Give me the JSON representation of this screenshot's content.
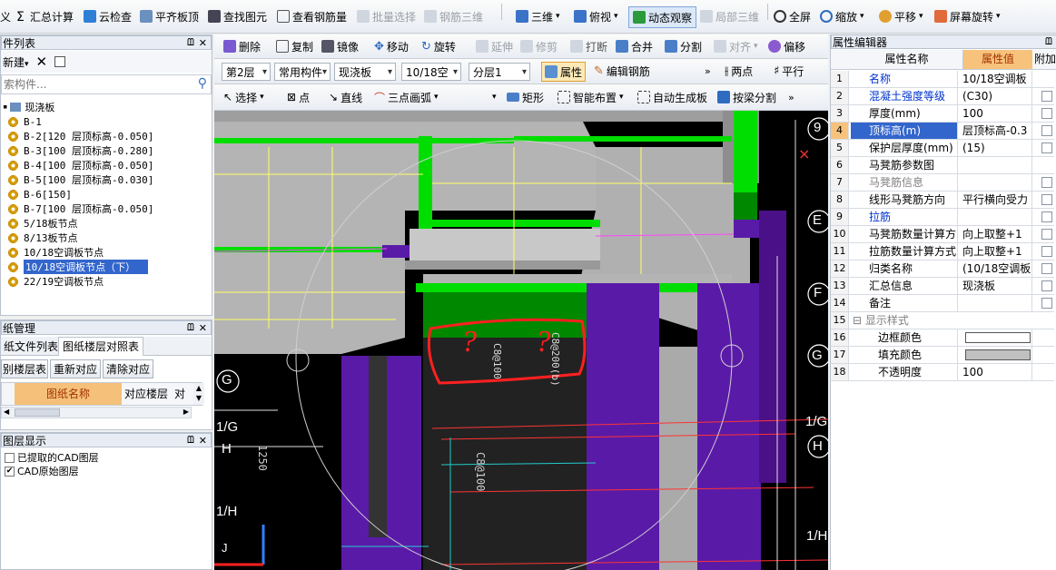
{
  "toolbar1": {
    "items": [
      "义",
      "汇总计算",
      "云检查",
      "平齐板顶",
      "查找图元",
      "查看钢筋量",
      "批量选择",
      "钢筋三维",
      "三维",
      "俯视",
      "动态观察",
      "局部三维",
      "全屏",
      "缩放",
      "平移",
      "屏幕旋转"
    ]
  },
  "left_panel": {
    "title": "件列表",
    "new_label": "新建",
    "search_placeholder": "索构件...",
    "root": "现浇板",
    "items": [
      "B-1",
      "B-2[120 层顶标高-0.050]",
      "B-3[100 层顶标高-0.280]",
      "B-4[100 层顶标高-0.050]",
      "B-5[100 层顶标高-0.030]",
      "B-6[150]",
      "B-7[100 层顶标高-0.050]",
      "5/18板节点",
      "8/13板节点",
      "10/18空调板节点",
      "10/18空调板节点（下）",
      "22/19空调板节点"
    ],
    "selected_index": 10
  },
  "drawing_panel": {
    "title": "纸管理",
    "tabs": [
      "纸文件列表",
      "图纸楼层对照表"
    ],
    "buttons": [
      "别楼层表",
      "重新对应",
      "清除对应"
    ],
    "columns": [
      "图纸名称",
      "对应楼层",
      "对应"
    ]
  },
  "layer_panel": {
    "title": "图层显示",
    "layers": [
      {
        "label": "已提取的CAD图层",
        "checked": false
      },
      {
        "label": "CAD原始图层",
        "checked": true
      }
    ]
  },
  "edit_toolbar": {
    "row1": [
      "删除",
      "复制",
      "镜像",
      "移动",
      "旋转",
      "延伸",
      "修剪",
      "打断",
      "合并",
      "分割",
      "对齐",
      "偏移"
    ],
    "row2_combos": [
      "第2层",
      "常用构件",
      "现浇板",
      "10/18空",
      "分层1"
    ],
    "row2_buttons": [
      "属性",
      "编辑钢筋",
      "两点",
      "平行"
    ],
    "row3": [
      "选择",
      "点",
      "直线",
      "三点画弧",
      "矩形",
      "智能布置",
      "自动生成板",
      "按梁分割"
    ]
  },
  "viewport": {
    "axis_labels": [
      "9",
      "E",
      "F",
      "G",
      "1/G",
      "H",
      "1/H",
      "J",
      "G",
      "1/G",
      "H",
      "1/H"
    ],
    "annotation_text": "? ?",
    "rebar_texts": [
      "C8@100",
      "C8@200(b)",
      "C8@100",
      "1250"
    ],
    "close_mark": "×"
  },
  "properties": {
    "title": "属性编辑器",
    "header": [
      "属性名称",
      "属性值",
      "附加"
    ],
    "rows": [
      {
        "n": "1",
        "name": "名称",
        "value": "10/18空调板",
        "style": "blue",
        "chk": false
      },
      {
        "n": "2",
        "name": "混凝土强度等级",
        "value": "(C30)",
        "style": "blue",
        "chk": true
      },
      {
        "n": "3",
        "name": "厚度(mm)",
        "value": "100",
        "style": "",
        "chk": true
      },
      {
        "n": "4",
        "name": "顶标高(m)",
        "value": "层顶标高-0.3",
        "style": "sel",
        "chk": true
      },
      {
        "n": "5",
        "name": "保护层厚度(mm)",
        "value": "(15)",
        "style": "",
        "chk": true
      },
      {
        "n": "6",
        "name": "马凳筋参数图",
        "value": "",
        "style": "",
        "chk": false
      },
      {
        "n": "7",
        "name": "马凳筋信息",
        "value": "",
        "style": "gray",
        "chk": true
      },
      {
        "n": "8",
        "name": "线形马凳筋方向",
        "value": "平行横向受力",
        "style": "",
        "chk": true
      },
      {
        "n": "9",
        "name": "拉筋",
        "value": "",
        "style": "blue",
        "chk": true
      },
      {
        "n": "10",
        "name": "马凳筋数量计算方",
        "value": "向上取整+1",
        "style": "",
        "chk": true
      },
      {
        "n": "11",
        "name": "拉筋数量计算方式",
        "value": "向上取整+1",
        "style": "",
        "chk": true
      },
      {
        "n": "12",
        "name": "归类名称",
        "value": "(10/18空调板",
        "style": "",
        "chk": true
      },
      {
        "n": "13",
        "name": "汇总信息",
        "value": "现浇板",
        "style": "",
        "chk": true
      },
      {
        "n": "14",
        "name": "备注",
        "value": "",
        "style": "",
        "chk": true
      },
      {
        "n": "15",
        "name": "显示样式",
        "value": "",
        "style": "group",
        "chk": false
      },
      {
        "n": "16",
        "name": "边框颜色",
        "value": "",
        "style": "sub",
        "chk": false
      },
      {
        "n": "17",
        "name": "填充颜色",
        "value": "",
        "style": "sub",
        "chk": false
      },
      {
        "n": "18",
        "name": "不透明度",
        "value": "100",
        "style": "sub",
        "chk": false
      }
    ]
  },
  "colors": {
    "green": "#00dd00",
    "purple": "#5a1aa8",
    "gray": "#b4b4b4",
    "bg": "#000000",
    "accent": "#3366cc"
  }
}
